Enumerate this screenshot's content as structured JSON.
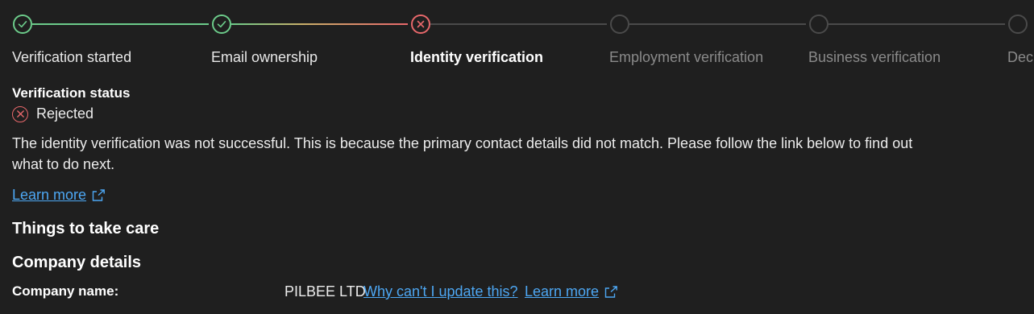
{
  "stepper": {
    "steps": [
      {
        "label": "Verification started",
        "state": "done",
        "icon": "check-icon"
      },
      {
        "label": "Email ownership",
        "state": "done",
        "icon": "check-icon"
      },
      {
        "label": "Identity verification",
        "state": "failed",
        "icon": "close-circle-icon"
      },
      {
        "label": "Employment verification",
        "state": "pending",
        "icon": ""
      },
      {
        "label": "Business verification",
        "state": "pending",
        "icon": ""
      },
      {
        "label": "Deci",
        "state": "pending",
        "icon": ""
      }
    ]
  },
  "status": {
    "title": "Verification status",
    "value": "Rejected",
    "icon": "close-circle-icon",
    "message": "The identity verification was not successful. This is because the primary contact details did not match. Please follow the link below to find out what to do next.",
    "learn_more": "Learn more"
  },
  "sections": {
    "things_title": "Things to take care",
    "company_title": "Company details"
  },
  "company": {
    "label": "Company name:",
    "value": "PILBEE LTD",
    "why_link": "Why can't I update this?",
    "learn_more": "Learn more"
  },
  "colors": {
    "background": "#1f1f1f",
    "success": "#6ccb8a",
    "error": "#e8686b",
    "link": "#4da7f3",
    "pending": "#4a4a4a"
  }
}
